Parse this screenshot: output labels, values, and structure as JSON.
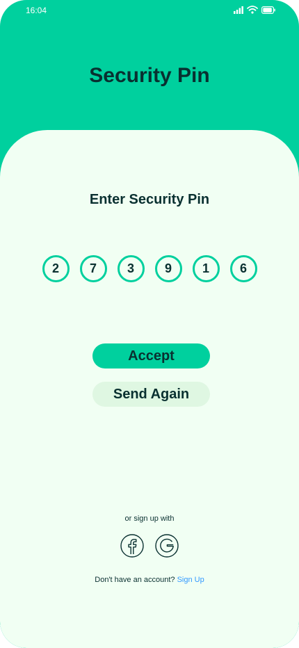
{
  "status_bar": {
    "time": "16:04"
  },
  "header": {
    "title": "Security Pin"
  },
  "pin": {
    "title": "Enter Security Pin",
    "digits": [
      "2",
      "7",
      "3",
      "9",
      "1",
      "6"
    ]
  },
  "buttons": {
    "accept": "Accept",
    "send_again": "Send Again"
  },
  "social": {
    "label": "or sign up with",
    "icons": [
      "facebook-icon",
      "google-icon"
    ]
  },
  "footer": {
    "prompt": "Don't have an account? ",
    "link": "Sign Up"
  },
  "colors": {
    "primary": "#00D09E",
    "background": "#F1FFF3",
    "secondary_button": "#DFF7E2",
    "text_dark": "#093030",
    "link": "#3299FF"
  }
}
